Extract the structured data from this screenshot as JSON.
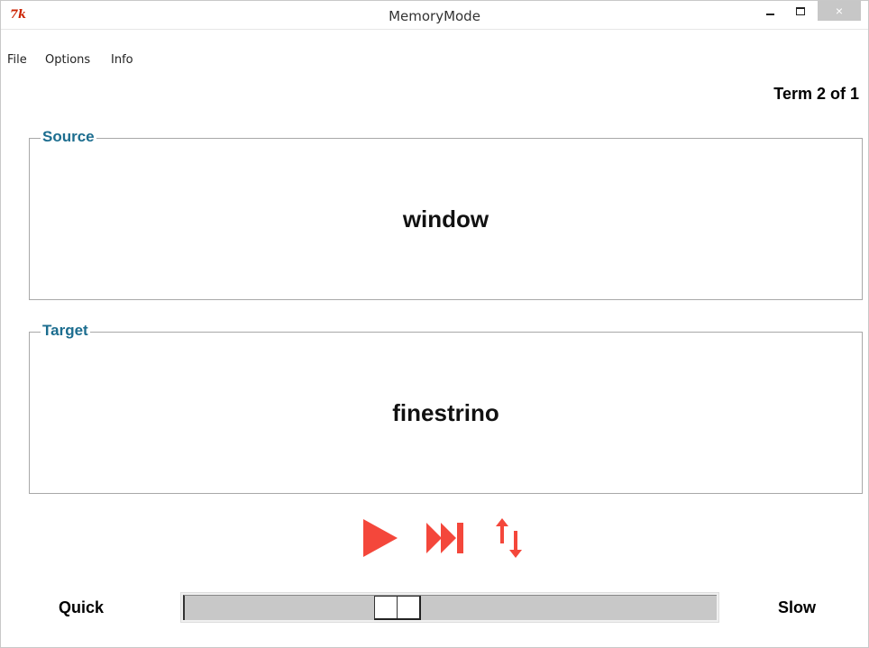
{
  "window": {
    "title": "MemoryMode",
    "logo_text": "7k",
    "close_glyph": "×"
  },
  "menu": {
    "items": [
      "File",
      "Options",
      "Info"
    ]
  },
  "term_counter": "Term 2 of 1",
  "source": {
    "label": "Source",
    "term": "window"
  },
  "target": {
    "label": "Target",
    "term": "finestrino"
  },
  "controls": {
    "play_icon": "play-icon",
    "skip_icon": "skip-forward-icon",
    "swap_icon": "swap-arrows-icon",
    "accent_color": "#f4473b"
  },
  "speed": {
    "min_label": "Quick",
    "max_label": "Slow",
    "value_fraction": 0.39
  }
}
